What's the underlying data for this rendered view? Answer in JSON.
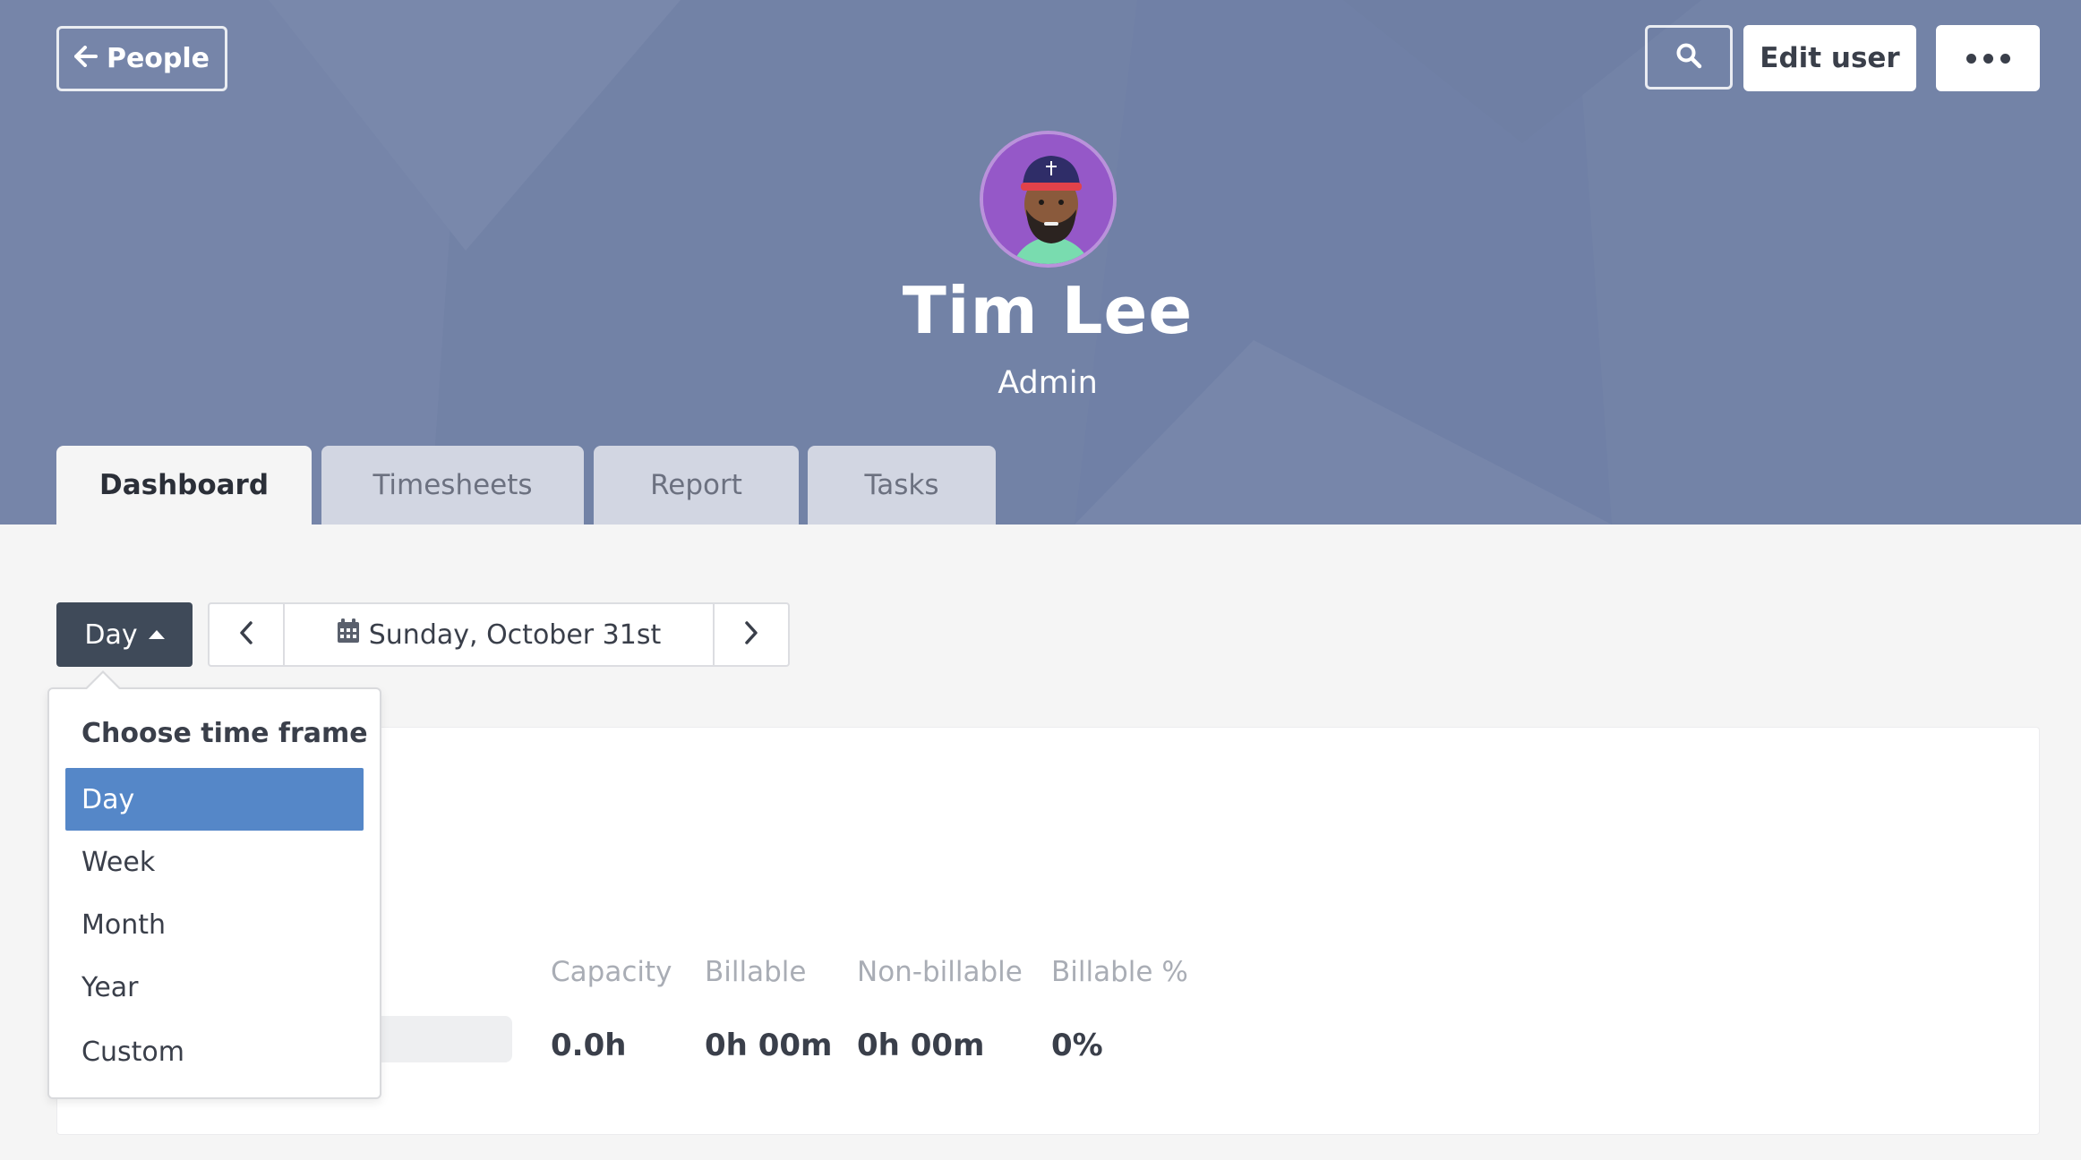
{
  "header": {
    "back_label": "People",
    "edit_label": "Edit user",
    "user_name": "Tim Lee",
    "user_role": "Admin"
  },
  "tabs": [
    {
      "label": "Dashboard",
      "active": true
    },
    {
      "label": "Timesheets",
      "active": false
    },
    {
      "label": "Report",
      "active": false
    },
    {
      "label": "Tasks",
      "active": false
    }
  ],
  "controls": {
    "timeframe_label": "Day",
    "date_label": "Sunday, October 31st"
  },
  "dropdown": {
    "heading": "Choose time frame",
    "items": [
      "Day",
      "Week",
      "Month",
      "Year",
      "Custom"
    ],
    "selected": "Day"
  },
  "stats": [
    {
      "label": "Capacity",
      "value": "0.0h"
    },
    {
      "label": "Billable",
      "value": "0h 00m"
    },
    {
      "label": "Non-billable",
      "value": "0h 00m"
    },
    {
      "label": "Billable %",
      "value": "0%"
    }
  ],
  "colors": {
    "header_bg": "#7483a8",
    "selected_item": "#5587c8",
    "dark_button": "#3f4a59",
    "avatar_bg": "#9558c8"
  },
  "icons": [
    "arrow-left-icon",
    "search-icon",
    "more-dots-icon",
    "caret-up-icon",
    "chevron-left-icon",
    "chevron-right-icon",
    "calendar-icon"
  ]
}
